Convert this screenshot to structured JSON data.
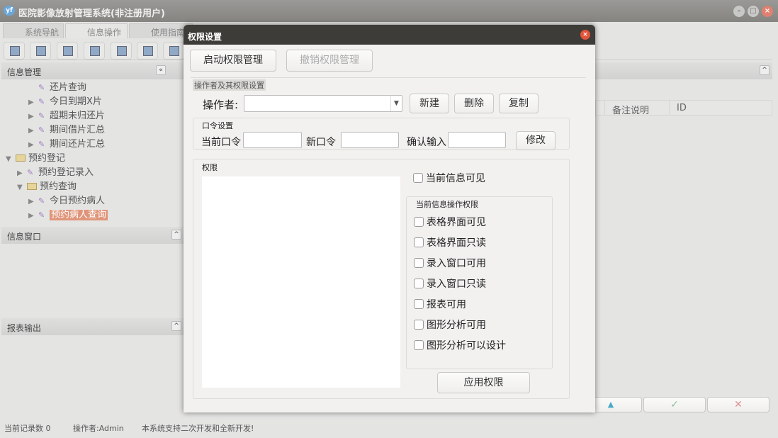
{
  "window": {
    "title": "医院影像放射管理系统(非注册用户)",
    "logo": "yf"
  },
  "tabs": [
    {
      "label": "系统导航"
    },
    {
      "label": "信息操作"
    },
    {
      "label": "使用指南"
    }
  ],
  "left": {
    "info_mgmt": "信息管理",
    "tree": [
      {
        "label": "还片查询",
        "level": 2,
        "arrow": ""
      },
      {
        "label": "今日到期X片",
        "level": 2,
        "arrow": "▶"
      },
      {
        "label": "超期未归还片",
        "level": 2,
        "arrow": "▶"
      },
      {
        "label": "期间借片汇总",
        "level": 2,
        "arrow": "▶"
      },
      {
        "label": "期间还片汇总",
        "level": 2,
        "arrow": "▶"
      },
      {
        "label": "预约登记",
        "level": 0,
        "arrow": "▼",
        "folder": true
      },
      {
        "label": "预约登记录入",
        "level": 1,
        "arrow": "▶"
      },
      {
        "label": "预约查询",
        "level": 1,
        "arrow": "▼",
        "folder": true
      },
      {
        "label": "今日预约病人",
        "level": 2,
        "arrow": "▶"
      },
      {
        "label": "预约病人查询",
        "level": 2,
        "arrow": "▶",
        "selected": true
      }
    ],
    "info_window": "信息窗口",
    "report_output": "报表输出"
  },
  "right": {
    "columns": [
      "备注说明",
      "ID"
    ]
  },
  "dialog": {
    "title": "权限设置",
    "start_btn": "启动权限管理",
    "revoke_btn": "撤销权限管理",
    "operator_group": "操作者及其权限设置",
    "operator_label": "操作者:",
    "operator_value": "",
    "new_btn": "新建",
    "delete_btn": "删除",
    "copy_btn": "复制",
    "pwd_group": "口令设置",
    "current_pwd": "当前口令",
    "new_pwd": "新口令",
    "confirm_pwd": "确认输入",
    "modify_btn": "修改",
    "perm_group": "权限",
    "visible_cb": "当前信息可见",
    "ops_group": "当前信息操作权限",
    "ops": [
      "表格界面可见",
      "表格界面只读",
      "录入窗口可用",
      "录入窗口只读",
      "报表可用",
      "图形分析可用",
      "图形分析可以设计"
    ],
    "apply_btn": "应用权限"
  },
  "status": {
    "records": "当前记录数 0",
    "operator": "操作者:Admin",
    "note": "本系统支持二次开发和全新开发!"
  }
}
